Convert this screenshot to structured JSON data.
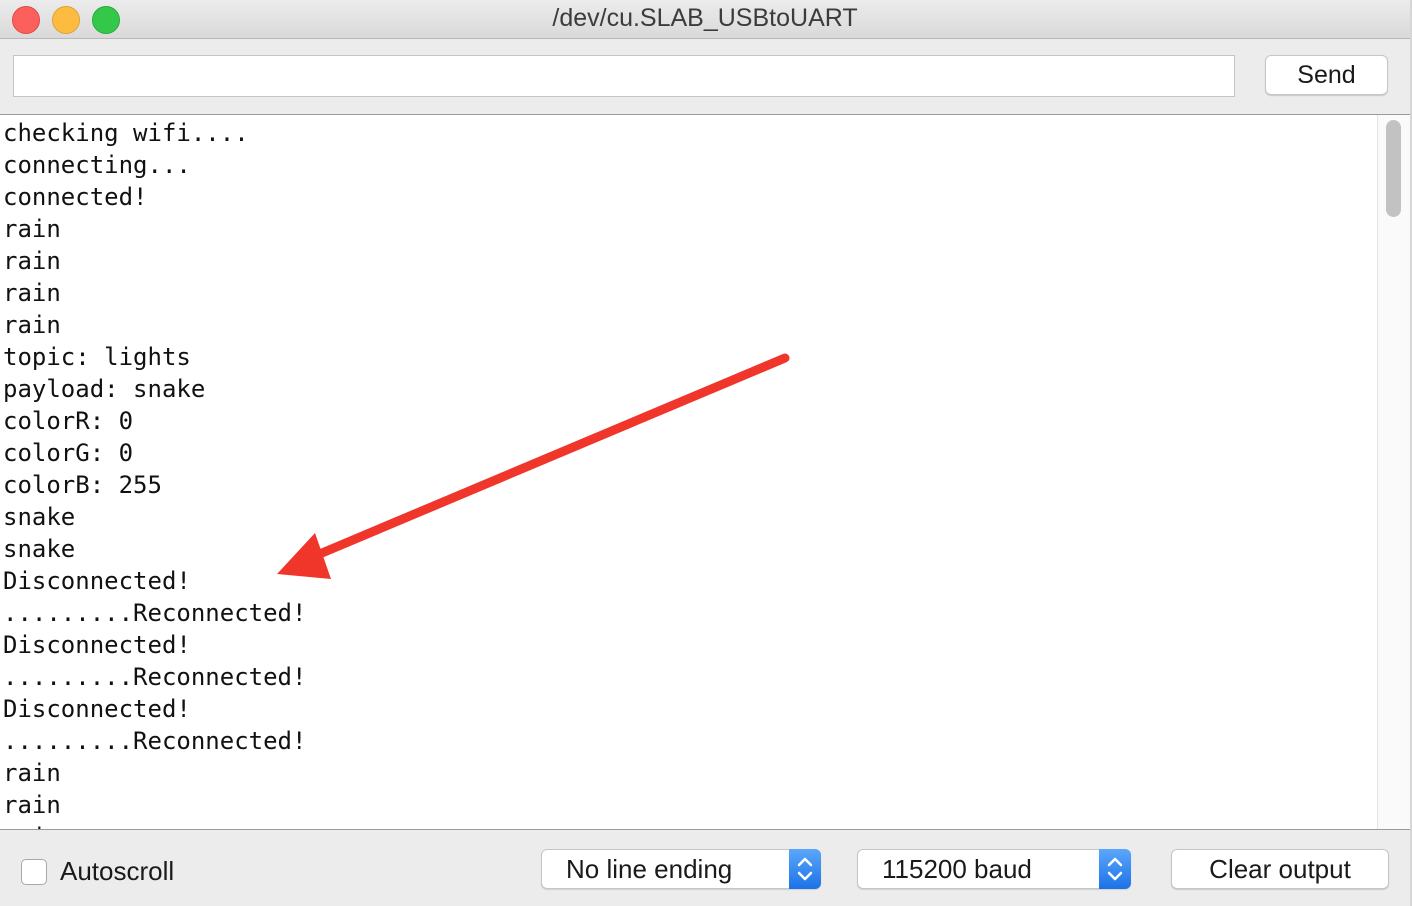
{
  "window": {
    "title": "/dev/cu.SLAB_USBtoUART"
  },
  "send": {
    "input_value": "",
    "button_label": "Send"
  },
  "output": {
    "lines": [
      "checking wifi....",
      "connecting...",
      "connected!",
      "rain",
      "rain",
      "rain",
      "rain",
      "topic: lights",
      "payload: snake",
      "colorR: 0",
      "colorG: 0",
      "colorB: 255",
      "snake",
      "snake",
      "Disconnected!",
      ".........Reconnected!",
      "Disconnected!",
      ".........Reconnected!",
      "Disconnected!",
      ".........Reconnected!",
      "rain",
      "rain",
      "rain"
    ]
  },
  "footer": {
    "autoscroll_label": "Autoscroll",
    "autoscroll_checked": false,
    "line_ending_value": "No line ending",
    "baud_value": "115200 baud",
    "clear_label": "Clear output"
  },
  "colors": {
    "annotation_arrow": "#f0362b",
    "stepper_accent": "#2f84f2"
  },
  "icons": {
    "arrow": "annotation-arrow-icon",
    "stepper": "chevron-up-down-icon"
  }
}
